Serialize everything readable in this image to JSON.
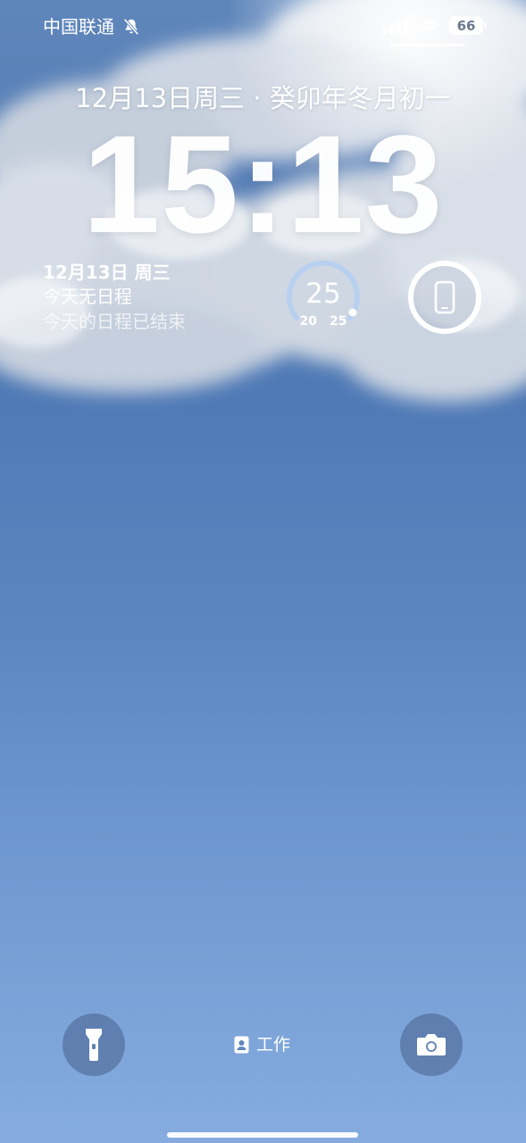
{
  "status_bar": {
    "carrier": "中国联通",
    "silent_icon": "bell-slash-icon",
    "signal_icon": "cellular-signal-icon",
    "wifi_icon": "wifi-icon",
    "battery_level": "66"
  },
  "lock_screen": {
    "date_line": "12月13日周三 · 癸卯年冬月初一",
    "time": "15:13"
  },
  "widgets": {
    "calendar": {
      "date": "12月13日 周三",
      "line2": "今天无日程",
      "line3": "今天的日程已结束"
    },
    "weather": {
      "current_temp": "25",
      "low": "20",
      "high": "25"
    },
    "device": {
      "icon": "iphone-icon"
    }
  },
  "bottom_controls": {
    "flashlight_icon": "flashlight-icon",
    "focus_icon": "id-badge-icon",
    "focus_label": "工作",
    "camera_icon": "camera-icon"
  },
  "colors": {
    "sky_top": "#5b7fb5",
    "sky_bottom": "#86acdf",
    "button_bg": "#46608c"
  }
}
